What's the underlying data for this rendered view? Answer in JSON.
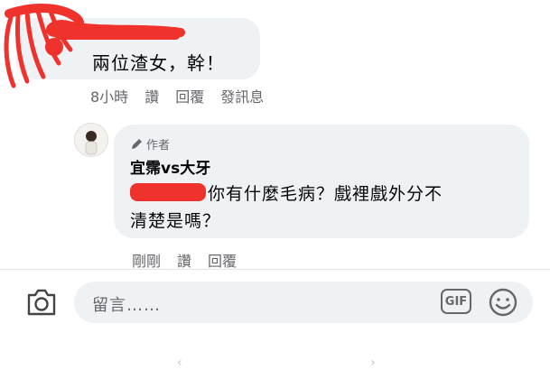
{
  "comment1": {
    "text": "兩位渣女，幹！",
    "time": "8小時",
    "like": "讚",
    "reply": "回覆",
    "message": "發訊息"
  },
  "reply": {
    "author_tag": "作者",
    "author_name": "宜霈vs大牙",
    "text_line1": "你有什麼毛病？戲裡戲外分不",
    "text_line2": "清楚是嗎？",
    "time": "剛剛",
    "like": "讚",
    "reply": "回覆"
  },
  "composer": {
    "placeholder": "留言……",
    "gif_label": "GIF"
  },
  "colors": {
    "redaction": "#f0322d",
    "bubble": "#eff2f5",
    "meta_text": "#65676b"
  }
}
